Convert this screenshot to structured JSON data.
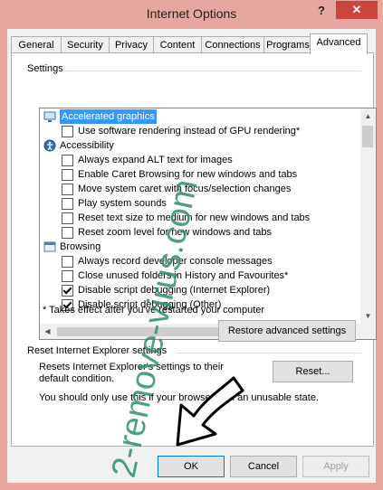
{
  "window": {
    "title": "Internet Options",
    "help_glyph": "?",
    "close_glyph": "✕"
  },
  "tabs": [
    {
      "label": "General",
      "active": false
    },
    {
      "label": "Security",
      "active": false
    },
    {
      "label": "Privacy",
      "active": false
    },
    {
      "label": "Content",
      "active": false
    },
    {
      "label": "Connections",
      "active": false
    },
    {
      "label": "Programs",
      "active": false
    },
    {
      "label": "Advanced",
      "active": true
    }
  ],
  "settings": {
    "group_label": "Settings",
    "items": [
      {
        "type": "category",
        "icon": "monitor-icon",
        "label": "Accelerated graphics",
        "selected": true
      },
      {
        "type": "checkbox",
        "label": "Use software rendering instead of GPU rendering*",
        "checked": false
      },
      {
        "type": "category",
        "icon": "accessibility-icon",
        "label": "Accessibility",
        "selected": false
      },
      {
        "type": "checkbox",
        "label": "Always expand ALT text for images",
        "checked": false
      },
      {
        "type": "checkbox",
        "label": "Enable Caret Browsing for new windows and tabs",
        "checked": false
      },
      {
        "type": "checkbox",
        "label": "Move system caret with focus/selection changes",
        "checked": false
      },
      {
        "type": "checkbox",
        "label": "Play system sounds",
        "checked": false
      },
      {
        "type": "checkbox",
        "label": "Reset text size to medium for new windows and tabs",
        "checked": false
      },
      {
        "type": "checkbox",
        "label": "Reset zoom level for new windows and tabs",
        "checked": false
      },
      {
        "type": "category",
        "icon": "browsing-icon",
        "label": "Browsing",
        "selected": false
      },
      {
        "type": "checkbox",
        "label": "Always record developer console messages",
        "checked": false
      },
      {
        "type": "checkbox",
        "label": "Close unused folders in History and Favourites*",
        "checked": false
      },
      {
        "type": "checkbox",
        "label": "Disable script debugging (Internet Explorer)",
        "checked": true
      },
      {
        "type": "checkbox",
        "label": "Disable script debugging (Other)",
        "checked": true
      }
    ],
    "footnote": "* Takes effect after you've restarted your computer",
    "restore_button": "Restore advanced settings"
  },
  "reset": {
    "group_label": "Reset Internet Explorer settings",
    "description": "Resets Internet Explorer's settings to their default condition.",
    "reset_button": "Reset...",
    "note": "You should only use this if your browser is in an unusable state."
  },
  "dialog_buttons": {
    "ok": "OK",
    "cancel": "Cancel",
    "apply": "Apply"
  },
  "watermark": {
    "text": "2-remove-virus.com",
    "color": "#2f8f6f"
  },
  "colors": {
    "titlebar": "#e8a6a0",
    "close_button": "#c7453a",
    "selection": "#3399ff"
  }
}
